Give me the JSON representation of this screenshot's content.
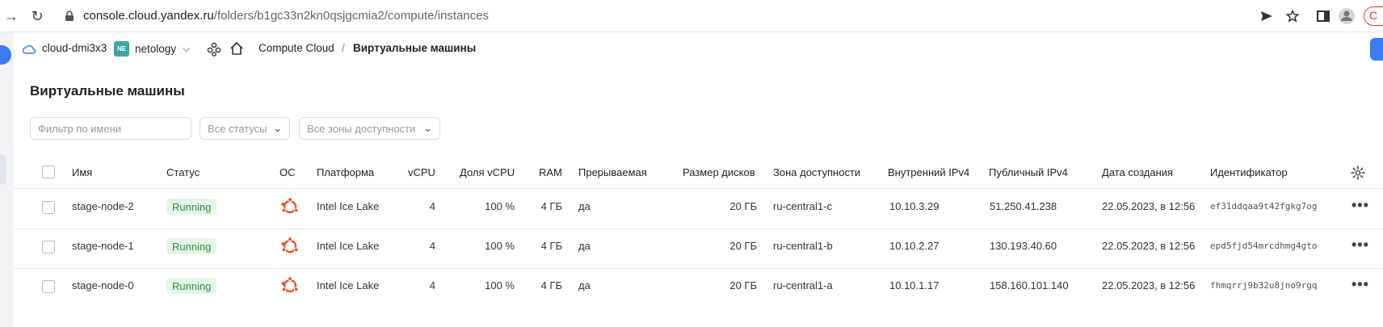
{
  "browser": {
    "url_domain": "console.cloud.yandex.ru",
    "url_path": "/folders/b1gc33n2kn0qsjgcmia2/compute/instances"
  },
  "header": {
    "cloud_name": "cloud-dmi3x3",
    "folder_badge": "NE",
    "folder_name": "netology",
    "breadcrumb_service": "Compute Cloud",
    "breadcrumb_sep": "/",
    "breadcrumb_current": "Виртуальные машины"
  },
  "page": {
    "title": "Виртуальные машины"
  },
  "filters": {
    "name_placeholder": "Фильтр по имени",
    "status_label": "Все статусы",
    "zone_label": "Все зоны доступности"
  },
  "table": {
    "columns": {
      "name": "Имя",
      "status": "Статус",
      "os": "ОС",
      "platform": "Платформа",
      "vcpu": "vCPU",
      "vcpu_share": "Доля vCPU",
      "ram": "RAM",
      "preemptible": "Прерываемая",
      "disk_size": "Размер дисков",
      "zone": "Зона доступности",
      "internal_ip": "Внутренний IPv4",
      "public_ip": "Публичный IPv4",
      "created": "Дата создания",
      "id": "Идентификатор"
    },
    "rows": [
      {
        "name": "stage-node-2",
        "status": "Running",
        "platform": "Intel Ice Lake",
        "vcpu": "4",
        "vcpu_share": "100 %",
        "ram": "4 ГБ",
        "preemptible": "да",
        "disk_size": "20 ГБ",
        "zone": "ru-central1-c",
        "internal_ip": "10.10.3.29",
        "public_ip": "51.250.41.238",
        "created": "22.05.2023, в 12:56",
        "id": "ef31ddqaa9t42fgkg7og"
      },
      {
        "name": "stage-node-1",
        "status": "Running",
        "platform": "Intel Ice Lake",
        "vcpu": "4",
        "vcpu_share": "100 %",
        "ram": "4 ГБ",
        "preemptible": "да",
        "disk_size": "20 ГБ",
        "zone": "ru-central1-b",
        "internal_ip": "10.10.2.27",
        "public_ip": "130.193.40.60",
        "created": "22.05.2023, в 12:56",
        "id": "epd5fjd54mrcdhmg4gto"
      },
      {
        "name": "stage-node-0",
        "status": "Running",
        "platform": "Intel Ice Lake",
        "vcpu": "4",
        "vcpu_share": "100 %",
        "ram": "4 ГБ",
        "preemptible": "да",
        "disk_size": "20 ГБ",
        "zone": "ru-central1-a",
        "internal_ip": "10.10.1.17",
        "public_ip": "158.160.101.140",
        "created": "22.05.2023, в 12:56",
        "id": "fhmqrrj9b32u8jno9rgq"
      }
    ]
  },
  "colors": {
    "accent": "#3b7cf5",
    "running_bg": "#e6f5e9",
    "running_text": "#2d8f3a",
    "ubuntu_orange": "#e95420"
  }
}
